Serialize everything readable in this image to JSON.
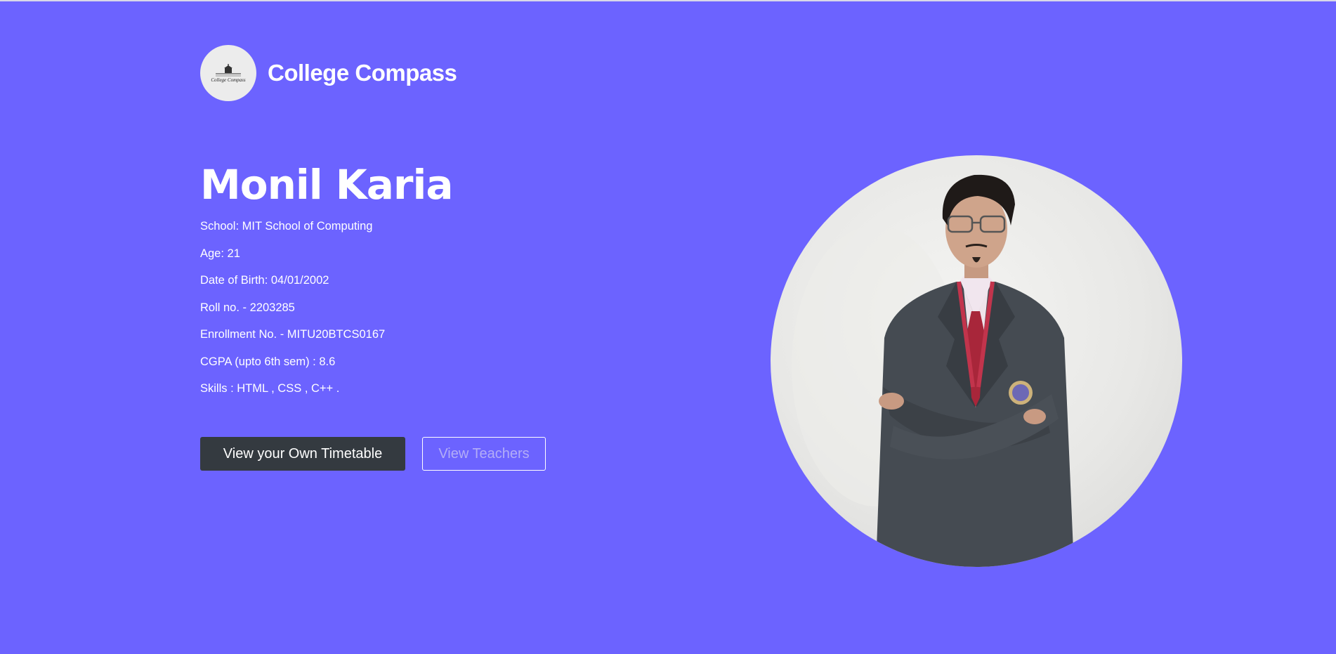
{
  "header": {
    "logo_icon": "college-building-logo",
    "logo_text": "College Compass",
    "brand": "College Compass"
  },
  "profile": {
    "name": "Monil Karia",
    "details": [
      "School: MIT School of Computing",
      "Age: 21",
      "Date of Birth: 04/01/2002",
      "Roll no. - 2203285",
      "Enrollment No. - MITU20BTCS0167",
      "CGPA (upto 6th sem) : 8.6",
      "Skills : HTML , CSS , C++ ."
    ],
    "photo": "student-portrait"
  },
  "actions": {
    "timetable_label": "View your Own Timetable",
    "teachers_label": "View Teachers"
  },
  "colors": {
    "background": "#6c63ff",
    "primary_button": "#343a40",
    "outline_text": "#b3adf7"
  }
}
